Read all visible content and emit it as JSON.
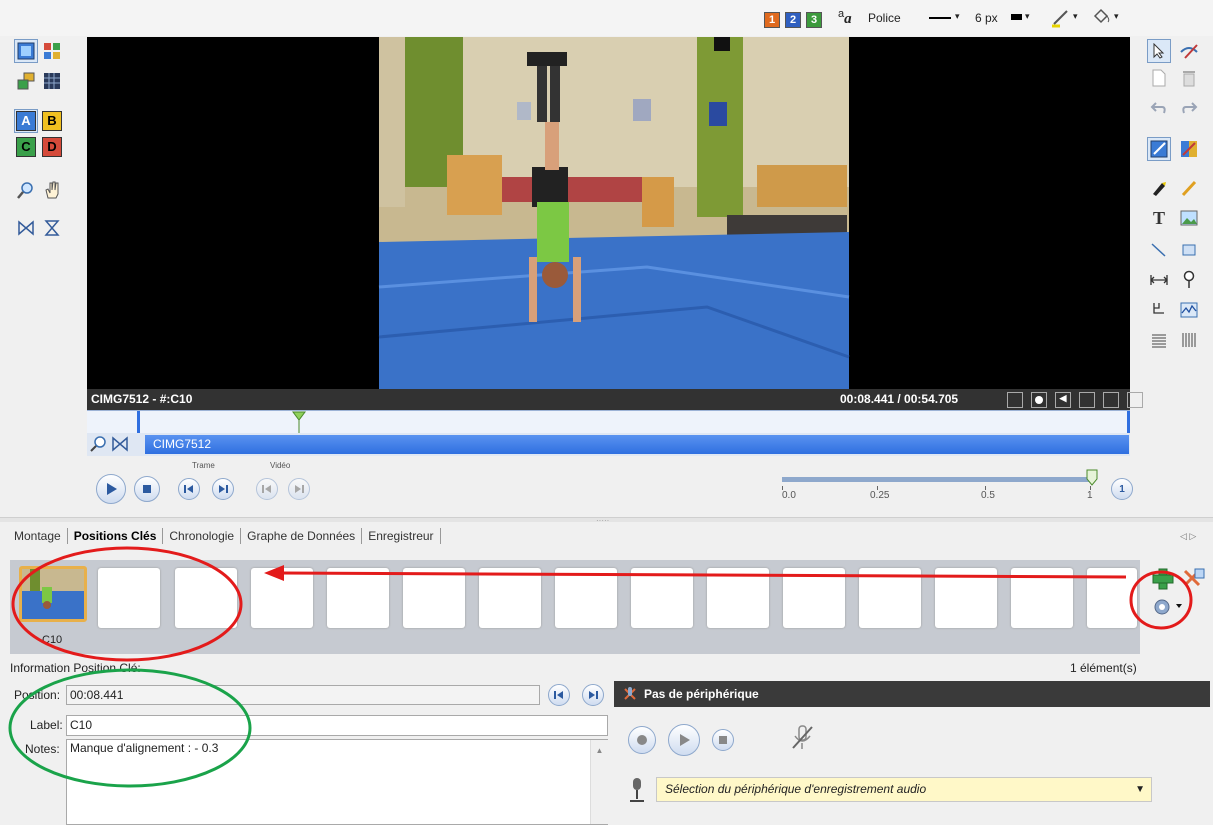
{
  "top_toolbar": {
    "grid_buttons": [
      "1",
      "2",
      "3"
    ],
    "font_label": "Police",
    "size_label": "6 px"
  },
  "left_tools": {
    "letters": [
      "A",
      "B",
      "C",
      "D"
    ]
  },
  "video": {
    "clip_info": "CIMG7512 - #:C10",
    "timecode": "00:08.441 / 00:54.705",
    "clip_name": "CIMG7512"
  },
  "playback": {
    "trame_label": "Trame",
    "video_label": "Vidéo",
    "speed_ticks": [
      "0.0",
      "0.25",
      "0.5",
      "1"
    ],
    "speed_value": "1",
    "speed_level": 1.0
  },
  "tabs": [
    {
      "label": "Montage"
    },
    {
      "label": "Positions Clés"
    },
    {
      "label": "Chronologie"
    },
    {
      "label": "Graphe de Données"
    },
    {
      "label": "Enregistreur"
    }
  ],
  "keyframes": {
    "first_label": "C10",
    "count_text": "1 élément(s)"
  },
  "info": {
    "section_title": "Information Position Clé:",
    "position_label": "Position:",
    "position_value": "00:08.441",
    "label_label": "Label:",
    "label_value": "C10",
    "notes_label": "Notes:",
    "notes_value": "Manque d'alignement : - 0.3"
  },
  "recorder": {
    "title": "Pas de périphérique",
    "device_select": "Sélection du périphérique d'enregistrement audio"
  },
  "colors": {
    "annotation_red": "#e31b1b",
    "annotation_green": "#1aa34a",
    "clip_blue": "#2f6fe0"
  }
}
